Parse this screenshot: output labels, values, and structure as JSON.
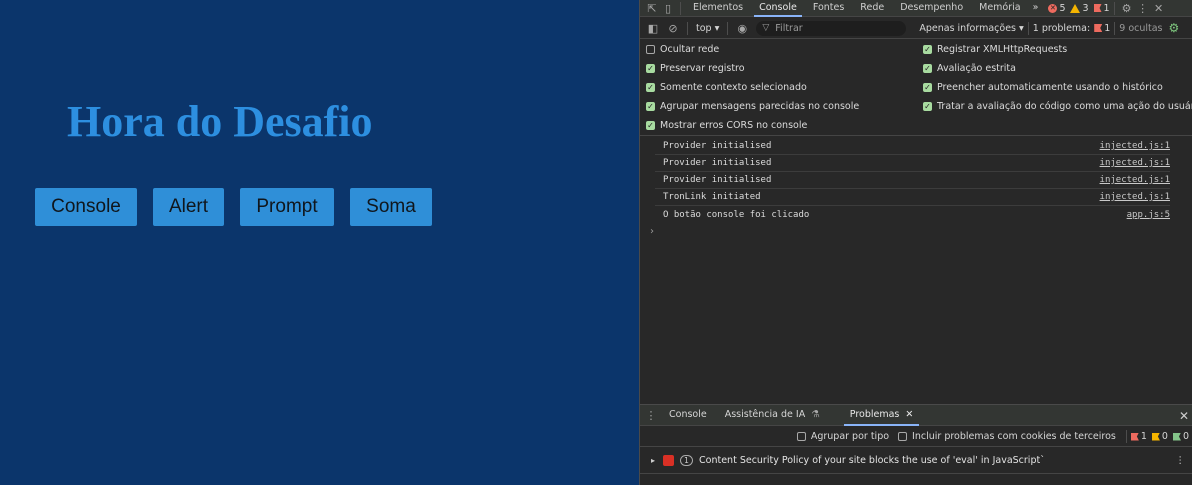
{
  "page": {
    "title": "Hora do Desafio",
    "buttons": [
      {
        "label": "Console"
      },
      {
        "label": "Alert"
      },
      {
        "label": "Prompt"
      },
      {
        "label": "Soma"
      }
    ]
  },
  "devtools": {
    "main_tabs": [
      "Elementos",
      "Console",
      "Fontes",
      "Rede",
      "Desempenho",
      "Memória"
    ],
    "active_tab": "Console",
    "more_tabs": "»",
    "badges": {
      "errors": "5",
      "warnings": "3",
      "issues": "1"
    },
    "toolbar": {
      "context": "top ▾",
      "filter_placeholder": "Filtrar",
      "levels": "Apenas informações ▾",
      "issues_label": "1 problema:",
      "issues_count": "1",
      "hidden": "9 ocultas"
    },
    "settings": {
      "left": [
        {
          "label": "Ocultar rede",
          "checked": false
        },
        {
          "label": "Preservar registro",
          "checked": true
        },
        {
          "label": "Somente contexto selecionado",
          "checked": true
        },
        {
          "label": "Agrupar mensagens parecidas no console",
          "checked": true
        },
        {
          "label": "Mostrar erros CORS no console",
          "checked": true
        }
      ],
      "right": [
        {
          "label": "Registrar XMLHttpRequests",
          "checked": true
        },
        {
          "label": "Avaliação estrita",
          "checked": true
        },
        {
          "label": "Preencher automaticamente usando o histórico",
          "checked": true
        },
        {
          "label": "Tratar a avaliação do código como uma ação do usuário",
          "checked": true
        }
      ]
    },
    "logs": [
      {
        "text": "Provider initialised",
        "source": "injected.js:1"
      },
      {
        "text": "Provider initialised",
        "source": "injected.js:1"
      },
      {
        "text": "Provider initialised",
        "source": "injected.js:1"
      },
      {
        "text": "TronLink initiated",
        "source": "injected.js:1"
      },
      {
        "text": "O botão console foi clicado",
        "source": "app.js:5"
      }
    ],
    "prompt_caret": "›",
    "drawer": {
      "tabs": [
        "Console",
        "Assistência de IA",
        "Problemas"
      ],
      "active_tab": "Problemas",
      "group_by_type": "Agrupar por tipo",
      "third_party": "Incluir problemas com cookies de terceiros",
      "counts": {
        "errors": "1",
        "warnings": "0",
        "info": "0"
      },
      "issue": {
        "count": "1",
        "text": "Content Security Policy of your site blocks the use of 'eval' in JavaScript`"
      }
    }
  }
}
